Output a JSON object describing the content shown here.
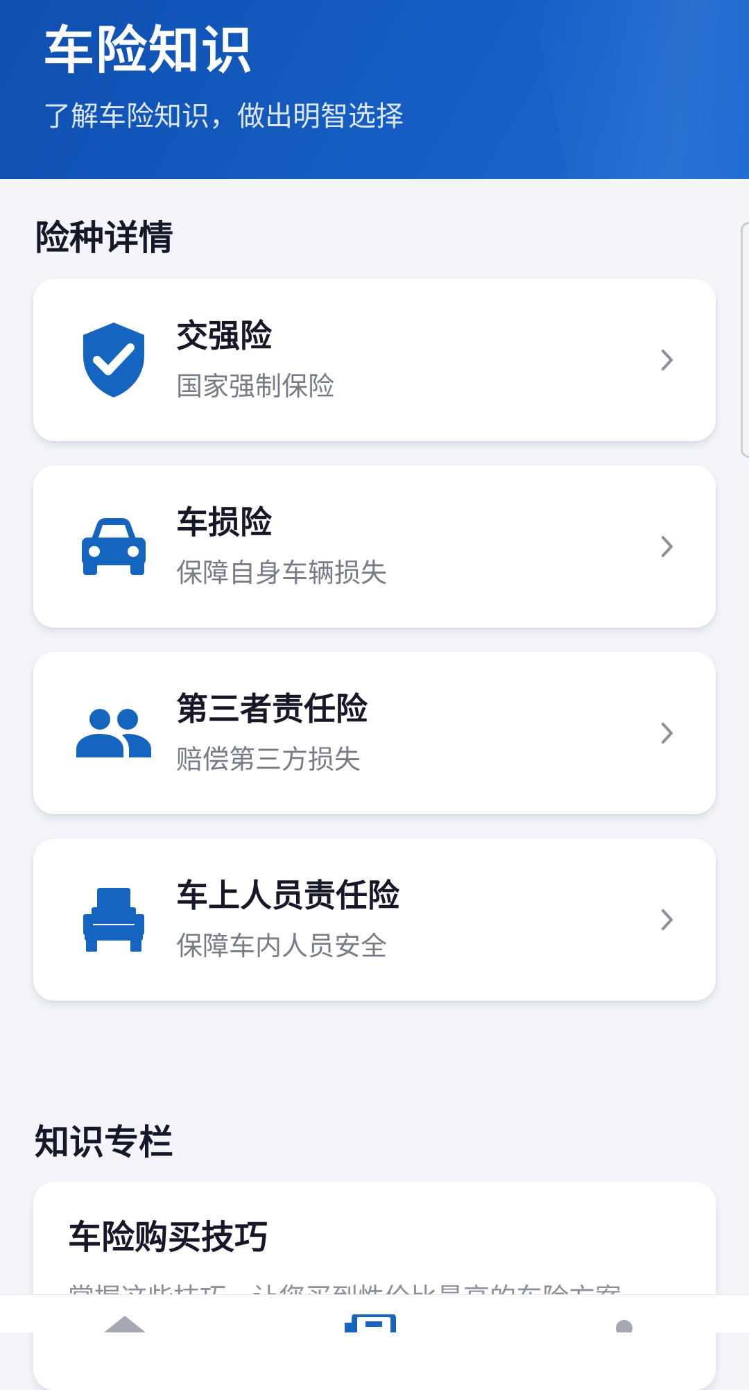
{
  "header": {
    "title": "车险知识",
    "subtitle": "了解车险知识，做出明智选择"
  },
  "insurance_section": {
    "title": "险种详情",
    "items": [
      {
        "title": "交强险",
        "desc": "国家强制保险",
        "icon": "shield-check-icon"
      },
      {
        "title": "车损险",
        "desc": "保障自身车辆损失",
        "icon": "car-icon"
      },
      {
        "title": "第三者责任险",
        "desc": "赔偿第三方损失",
        "icon": "people-icon"
      },
      {
        "title": "车上人员责任险",
        "desc": "保障车内人员安全",
        "icon": "car-seat-icon"
      }
    ]
  },
  "knowledge_section": {
    "title": "知识专栏",
    "articles": [
      {
        "title": "车险购买技巧",
        "desc": "掌握这些技巧，让您买到性价比最高的车险方案"
      }
    ]
  },
  "bottom_nav": {
    "items": [
      {
        "icon": "home-icon"
      },
      {
        "icon": "article-icon"
      },
      {
        "icon": "profile-icon"
      }
    ]
  },
  "colors": {
    "primary": "#1565C0",
    "header_start": "#0F4FB0",
    "header_end": "#1B6AD2",
    "background": "#F3F5FA",
    "text_primary": "#16182A",
    "text_secondary": "#777C88"
  }
}
